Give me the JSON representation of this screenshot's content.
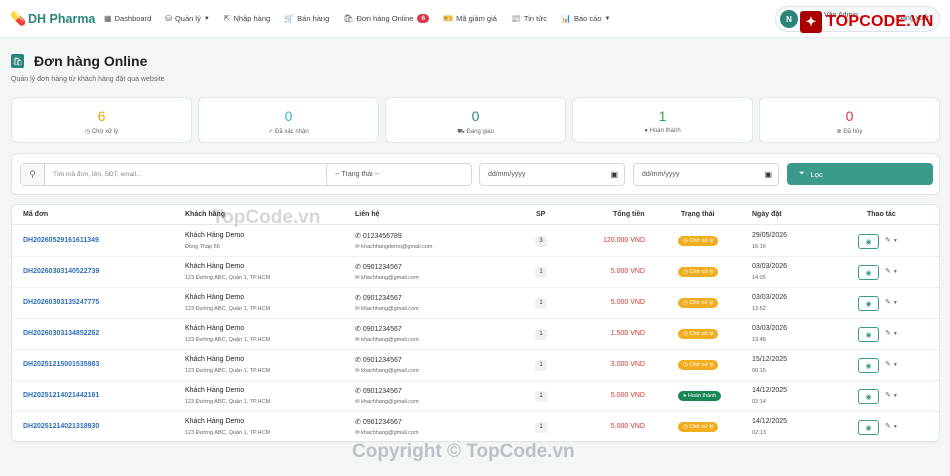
{
  "brand": {
    "name": "DH Pharma"
  },
  "nav": [
    {
      "label": "Dashboard",
      "icon": "grid-icon",
      "glyph": "▦",
      "caret": false
    },
    {
      "label": "Quản lý",
      "icon": "database-icon",
      "glyph": "⛁",
      "caret": true
    },
    {
      "label": "Nhập hàng",
      "icon": "import-icon",
      "glyph": "⇱",
      "caret": false
    },
    {
      "label": "Bán hàng",
      "icon": "cart-icon",
      "glyph": "🛒",
      "caret": false
    },
    {
      "label": "Đơn hàng Online",
      "icon": "bag-icon",
      "glyph": "🛍",
      "caret": false,
      "badge": "6"
    },
    {
      "label": "Mã giảm giá",
      "icon": "ticket-icon",
      "glyph": "🎫",
      "caret": false
    },
    {
      "label": "Tin tức",
      "icon": "newspaper-icon",
      "glyph": "📰",
      "caret": false
    },
    {
      "label": "Báo cáo",
      "icon": "chart-icon",
      "glyph": "📊",
      "caret": true
    }
  ],
  "user": {
    "initial": "N",
    "name": "Văn Admin",
    "logout": "Đăng xuất"
  },
  "watermark": {
    "logo_text": "TOPCODE.VN",
    "mid": "TopCode.vn",
    "bottom": "Copyright © TopCode.vn"
  },
  "page": {
    "title": "Đơn hàng Online",
    "subtitle": "Quản lý đơn hàng từ khách hàng đặt qua website"
  },
  "stats": [
    {
      "value": "6",
      "label": "Chờ xử lý",
      "color": "#e0a800",
      "icon": "clock-icon",
      "glyph": "◷"
    },
    {
      "value": "0",
      "label": "Đã xác nhận",
      "color": "#3bb5c7",
      "icon": "check-circle-icon",
      "glyph": "✓"
    },
    {
      "value": "0",
      "label": "Đang giao",
      "color": "#2a8578",
      "icon": "truck-icon",
      "glyph": "⛟"
    },
    {
      "value": "1",
      "label": "Hoàn thành",
      "color": "#28a745",
      "icon": "check-filled-icon",
      "glyph": "●"
    },
    {
      "value": "0",
      "label": "Đã hủy",
      "color": "#dc3545",
      "icon": "x-circle-icon",
      "glyph": "⊗"
    }
  ],
  "filters": {
    "search_placeholder": "Tìm mã đơn, tên, SĐT, email...",
    "status_select": "-- Trạng thái --",
    "date_from": "dd/mm/yyyy",
    "date_to": "dd/mm/yyyy",
    "filter_button": "Lọc"
  },
  "table": {
    "headers": {
      "order_id": "Mã đơn",
      "customer": "Khách hàng",
      "contact": "Liên hệ",
      "qty": "SP",
      "total": "Tổng tiền",
      "status": "Trạng thái",
      "date": "Ngày đặt",
      "actions": "Thao tác"
    },
    "rows": [
      {
        "order_id": "DH20260529161611349",
        "name": "Khách Hàng Demo",
        "address": "Đồng Tháp 66",
        "phone": "0123456789",
        "email": "khachhangdemo@gmail.com",
        "qty": "3",
        "total": "120.000 VND",
        "status": "Chờ xử lý",
        "status_type": "pending",
        "date": "29/05/2026",
        "time": "16:16"
      },
      {
        "order_id": "DH20260303140522739",
        "name": "Khách Hàng Demo",
        "address": "123 Đường ABC, Quận 1, TP.HCM",
        "phone": "0901234567",
        "email": "khachhang@gmail.com",
        "qty": "1",
        "total": "5.000 VND",
        "status": "Chờ xử lý",
        "status_type": "pending",
        "date": "03/03/2026",
        "time": "14:05"
      },
      {
        "order_id": "DH20260303135247775",
        "name": "Khách Hàng Demo",
        "address": "123 Đường ABC, Quận 1, TP.HCM",
        "phone": "0901234567",
        "email": "khachhang@gmail.com",
        "qty": "1",
        "total": "5.000 VND",
        "status": "Chờ xử lý",
        "status_type": "pending",
        "date": "03/03/2026",
        "time": "13:52"
      },
      {
        "order_id": "DH20260303134852262",
        "name": "Khách Hàng Demo",
        "address": "123 Đường ABC, Quận 1, TP.HCM",
        "phone": "0901234567",
        "email": "khachhang@gmail.com",
        "qty": "1",
        "total": "1.500 VND",
        "status": "Chờ xử lý",
        "status_type": "pending",
        "date": "03/03/2026",
        "time": "13:48"
      },
      {
        "order_id": "DH20251215001535983",
        "name": "Khách Hàng Demo",
        "address": "123 Đường ABC, Quận 1, TP.HCM",
        "phone": "0901234567",
        "email": "khachhang@gmail.com",
        "qty": "1",
        "total": "3.000 VND",
        "status": "Chờ xử lý",
        "status_type": "pending",
        "date": "15/12/2025",
        "time": "00:15"
      },
      {
        "order_id": "DH20251214021442161",
        "name": "Khách Hàng Demo",
        "address": "123 Đường ABC, Quận 1, TP.HCM",
        "phone": "0901234567",
        "email": "khachhang@gmail.com",
        "qty": "1",
        "total": "5.000 VND",
        "status": "Hoàn thành",
        "status_type": "done",
        "date": "14/12/2025",
        "time": "02:14"
      },
      {
        "order_id": "DH20251214021318930",
        "name": "Khách Hàng Demo",
        "address": "123 Đường ABC, Quận 1, TP.HCM",
        "phone": "0901234567",
        "email": "khachhang@gmail.com",
        "qty": "1",
        "total": "5.000 VND",
        "status": "Chờ xử lý",
        "status_type": "pending",
        "date": "14/12/2025",
        "time": "02:13"
      }
    ]
  }
}
